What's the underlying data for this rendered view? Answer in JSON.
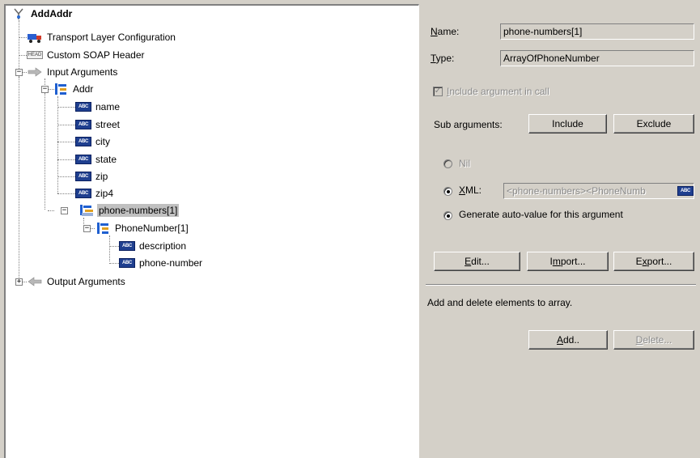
{
  "tree": {
    "root": "AddAddr",
    "transport": "Transport Layer Configuration",
    "soap_header": "Custom SOAP Header",
    "input_args": "Input Arguments",
    "addr": "Addr",
    "name": "name",
    "street": "street",
    "city": "city",
    "state": "state",
    "zip": "zip",
    "zip4": "zip4",
    "phone_numbers": "phone-numbers[1]",
    "phone_number_item": "PhoneNumber[1]",
    "description": "description",
    "phone_number": "phone-number",
    "output_args": "Output Arguments",
    "expander_minus": "−",
    "expander_plus": "+"
  },
  "props": {
    "name_label_u": "N",
    "name_label_rest": "ame:",
    "name_value": "phone-numbers[1]",
    "type_label_u": "T",
    "type_label_rest": "ype:",
    "type_value": "ArrayOfPhoneNumber",
    "include_arg_u": "I",
    "include_arg_rest": "nclude argument in call",
    "sub_arguments": "Sub arguments:",
    "include_btn": "Include",
    "exclude_btn": "Exclude",
    "nil": "Nil",
    "xml_u": "X",
    "xml_rest": "ML:",
    "xml_value": "<phone-numbers><PhoneNumb",
    "generate": "Generate auto-value for this argument",
    "edit_u": "E",
    "edit_rest": "dit...",
    "import_pre": "I",
    "import_u": "m",
    "import_rest": "port...",
    "export_pre": "E",
    "export_u": "x",
    "export_rest": "port...",
    "array_help": "Add and delete elements to array.",
    "add_u": "A",
    "add_rest": "dd..",
    "delete_u": "D",
    "delete_rest": "elete..."
  },
  "icons": {
    "abc_text": "ABC",
    "head_text": "HEAD"
  },
  "colors": {
    "background": "#d4d0c8",
    "selection": "#c0c0c0",
    "tree_icon_blue": "#1f3f8f"
  }
}
